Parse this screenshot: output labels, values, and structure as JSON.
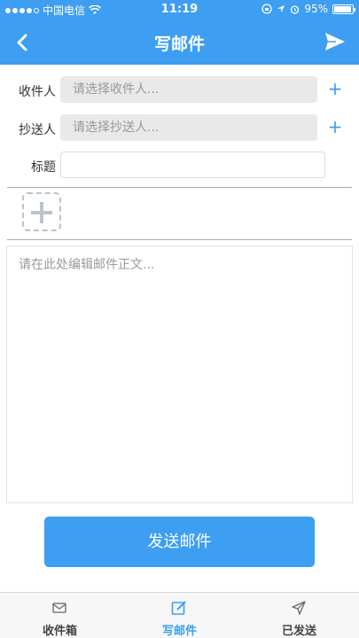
{
  "status_bar": {
    "carrier": "中国电信",
    "time": "11:19",
    "battery": "95%",
    "battery_level": 0.95
  },
  "nav": {
    "title": "写邮件",
    "back_icon": "chevron-left-icon",
    "send_icon": "paper-plane-icon"
  },
  "form": {
    "to_label": "收件人",
    "to_placeholder": "请选择收件人...",
    "cc_label": "抄送人",
    "cc_placeholder": "请选择抄送人...",
    "subject_label": "标题",
    "subject_value": "",
    "add_symbol": "+",
    "body_placeholder": "请在此处编辑邮件正文..."
  },
  "send_button_label": "发送邮件",
  "tabs": [
    {
      "label": "收件箱",
      "icon": "inbox-icon",
      "active": false
    },
    {
      "label": "写邮件",
      "icon": "compose-icon",
      "active": true
    },
    {
      "label": "已发送",
      "icon": "sent-icon",
      "active": false
    }
  ],
  "colors": {
    "accent": "#3d9ef2",
    "field_bg": "#e9e9ea",
    "tab_inactive": "#444444"
  }
}
